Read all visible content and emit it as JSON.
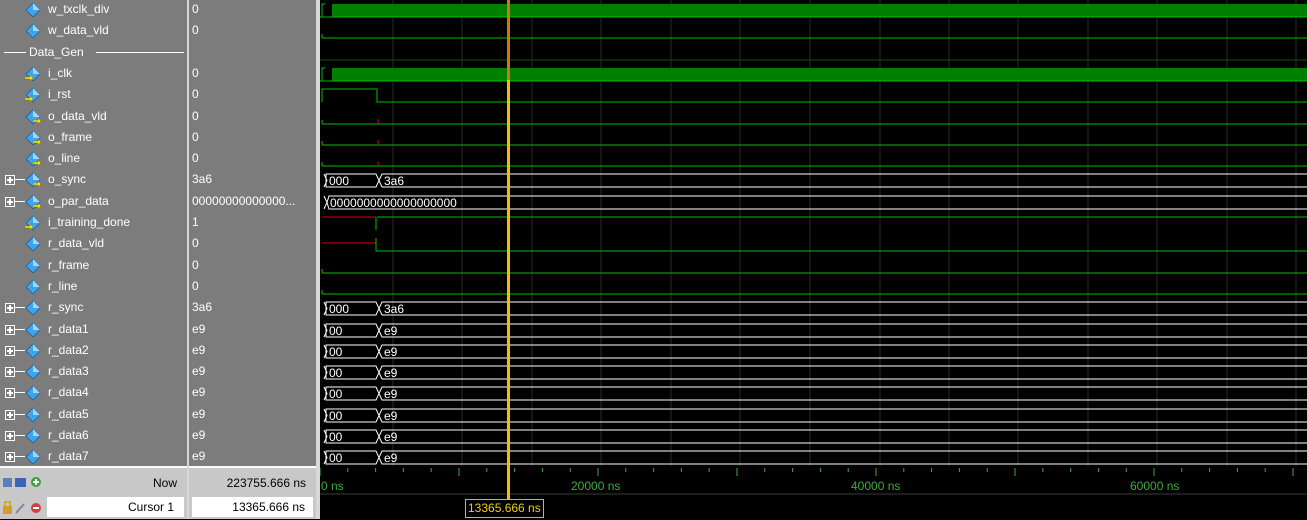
{
  "colors": {
    "wave": "#00c000",
    "bus_fill": "#008000",
    "cursor": "#f0c000",
    "red": "#e00000",
    "grid": "#2a2a2a",
    "panel": "#7c7c7c"
  },
  "signals": [
    {
      "name": "w_txclk_div",
      "value": "0",
      "kind": "clk",
      "icon": "blue-diamond",
      "expand": false
    },
    {
      "name": "w_data_vld",
      "value": "0",
      "kind": "bit",
      "icon": "blue-diamond",
      "expand": false
    },
    {
      "group": "Data_Gen"
    },
    {
      "name": "i_clk",
      "value": "0",
      "kind": "clk",
      "icon": "input-diamond",
      "expand": false
    },
    {
      "name": "i_rst",
      "value": "0",
      "kind": "rst",
      "icon": "input-diamond",
      "expand": false
    },
    {
      "name": "o_data_vld",
      "value": "0",
      "kind": "bitred",
      "icon": "output-diamond",
      "expand": false
    },
    {
      "name": "o_frame",
      "value": "0",
      "kind": "bitred",
      "icon": "output-diamond",
      "expand": false
    },
    {
      "name": "o_line",
      "value": "0",
      "kind": "bitred",
      "icon": "output-diamond",
      "expand": false
    },
    {
      "name": "o_sync",
      "value": "3a6",
      "kind": "bus",
      "icon": "output-diamond",
      "expand": true,
      "bus": [
        "000",
        "3a6"
      ]
    },
    {
      "name": "o_par_data",
      "value": "00000000000000...",
      "kind": "buslong",
      "icon": "output-diamond",
      "expand": true,
      "bus": [
        "0000000000000000000"
      ]
    },
    {
      "name": "i_training_done",
      "value": "1",
      "kind": "train",
      "icon": "input-diamond",
      "expand": false
    },
    {
      "name": "r_data_vld",
      "value": "0",
      "kind": "rvld",
      "icon": "blue-diamond",
      "expand": false
    },
    {
      "name": "r_frame",
      "value": "0",
      "kind": "bit",
      "icon": "blue-diamond",
      "expand": false
    },
    {
      "name": "r_line",
      "value": "0",
      "kind": "bit",
      "icon": "blue-diamond",
      "expand": false
    },
    {
      "name": "r_sync",
      "value": "3a6",
      "kind": "bus",
      "icon": "blue-diamond",
      "expand": true,
      "bus": [
        "000",
        "3a6"
      ]
    },
    {
      "name": "r_data1",
      "value": "e9",
      "kind": "bus",
      "icon": "blue-diamond",
      "expand": true,
      "bus": [
        "00",
        "e9"
      ]
    },
    {
      "name": "r_data2",
      "value": "e9",
      "kind": "bus",
      "icon": "blue-diamond",
      "expand": true,
      "bus": [
        "00",
        "e9"
      ]
    },
    {
      "name": "r_data3",
      "value": "e9",
      "kind": "bus",
      "icon": "blue-diamond",
      "expand": true,
      "bus": [
        "00",
        "e9"
      ]
    },
    {
      "name": "r_data4",
      "value": "e9",
      "kind": "bus",
      "icon": "blue-diamond",
      "expand": true,
      "bus": [
        "00",
        "e9"
      ]
    },
    {
      "name": "r_data5",
      "value": "e9",
      "kind": "bus",
      "icon": "blue-diamond",
      "expand": true,
      "bus": [
        "00",
        "e9"
      ]
    },
    {
      "name": "r_data6",
      "value": "e9",
      "kind": "bus",
      "icon": "blue-diamond",
      "expand": true,
      "bus": [
        "00",
        "e9"
      ]
    },
    {
      "name": "r_data7",
      "value": "e9",
      "kind": "bus",
      "icon": "blue-diamond",
      "expand": true,
      "bus": [
        "00",
        "e9"
      ]
    }
  ],
  "status": {
    "now_label": "Now",
    "now_value": "223755.666 ns",
    "cursor_label": "Cursor 1",
    "cursor_value": "13365.666 ns"
  },
  "timeline": {
    "ticks": [
      "0 ns",
      "20000 ns",
      "40000 ns",
      "60000 ns"
    ],
    "cursor_tag": "13365.666 ns"
  }
}
